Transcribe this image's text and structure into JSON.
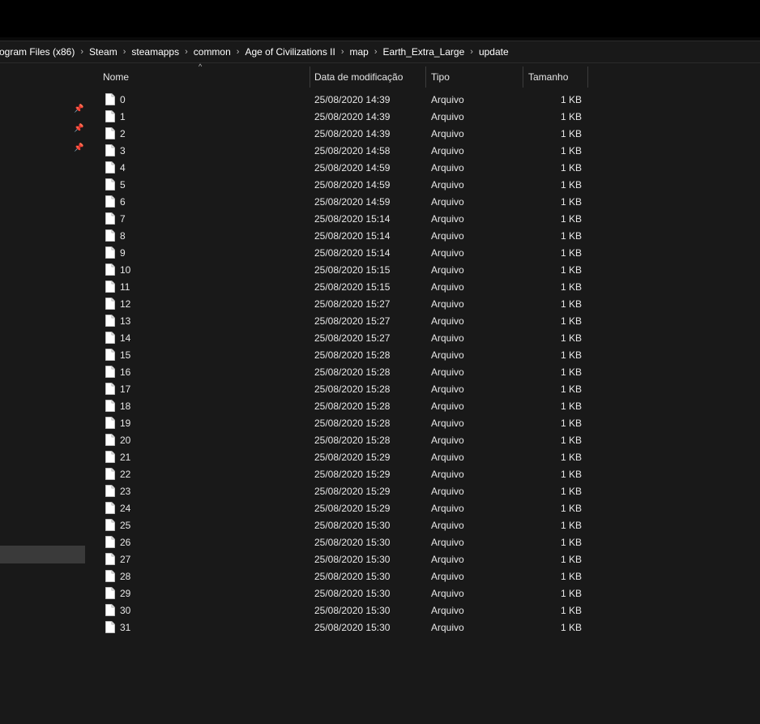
{
  "breadcrumb": [
    "rogram Files (x86)",
    "Steam",
    "steamapps",
    "common",
    "Age of Civilizations II",
    "map",
    "Earth_Extra_Large",
    "update"
  ],
  "breadcrumb_separator": "›",
  "columns": {
    "name": "Nome",
    "date": "Data de modificação",
    "type": "Tipo",
    "size": "Tamanho",
    "sort_indicator": "^"
  },
  "files": [
    {
      "name": "0",
      "date": "25/08/2020 14:39",
      "type": "Arquivo",
      "size": "1 KB"
    },
    {
      "name": "1",
      "date": "25/08/2020 14:39",
      "type": "Arquivo",
      "size": "1 KB"
    },
    {
      "name": "2",
      "date": "25/08/2020 14:39",
      "type": "Arquivo",
      "size": "1 KB"
    },
    {
      "name": "3",
      "date": "25/08/2020 14:58",
      "type": "Arquivo",
      "size": "1 KB"
    },
    {
      "name": "4",
      "date": "25/08/2020 14:59",
      "type": "Arquivo",
      "size": "1 KB"
    },
    {
      "name": "5",
      "date": "25/08/2020 14:59",
      "type": "Arquivo",
      "size": "1 KB"
    },
    {
      "name": "6",
      "date": "25/08/2020 14:59",
      "type": "Arquivo",
      "size": "1 KB"
    },
    {
      "name": "7",
      "date": "25/08/2020 15:14",
      "type": "Arquivo",
      "size": "1 KB"
    },
    {
      "name": "8",
      "date": "25/08/2020 15:14",
      "type": "Arquivo",
      "size": "1 KB"
    },
    {
      "name": "9",
      "date": "25/08/2020 15:14",
      "type": "Arquivo",
      "size": "1 KB"
    },
    {
      "name": "10",
      "date": "25/08/2020 15:15",
      "type": "Arquivo",
      "size": "1 KB"
    },
    {
      "name": "11",
      "date": "25/08/2020 15:15",
      "type": "Arquivo",
      "size": "1 KB"
    },
    {
      "name": "12",
      "date": "25/08/2020 15:27",
      "type": "Arquivo",
      "size": "1 KB"
    },
    {
      "name": "13",
      "date": "25/08/2020 15:27",
      "type": "Arquivo",
      "size": "1 KB"
    },
    {
      "name": "14",
      "date": "25/08/2020 15:27",
      "type": "Arquivo",
      "size": "1 KB"
    },
    {
      "name": "15",
      "date": "25/08/2020 15:28",
      "type": "Arquivo",
      "size": "1 KB"
    },
    {
      "name": "16",
      "date": "25/08/2020 15:28",
      "type": "Arquivo",
      "size": "1 KB"
    },
    {
      "name": "17",
      "date": "25/08/2020 15:28",
      "type": "Arquivo",
      "size": "1 KB"
    },
    {
      "name": "18",
      "date": "25/08/2020 15:28",
      "type": "Arquivo",
      "size": "1 KB"
    },
    {
      "name": "19",
      "date": "25/08/2020 15:28",
      "type": "Arquivo",
      "size": "1 KB"
    },
    {
      "name": "20",
      "date": "25/08/2020 15:28",
      "type": "Arquivo",
      "size": "1 KB"
    },
    {
      "name": "21",
      "date": "25/08/2020 15:29",
      "type": "Arquivo",
      "size": "1 KB"
    },
    {
      "name": "22",
      "date": "25/08/2020 15:29",
      "type": "Arquivo",
      "size": "1 KB"
    },
    {
      "name": "23",
      "date": "25/08/2020 15:29",
      "type": "Arquivo",
      "size": "1 KB"
    },
    {
      "name": "24",
      "date": "25/08/2020 15:29",
      "type": "Arquivo",
      "size": "1 KB"
    },
    {
      "name": "25",
      "date": "25/08/2020 15:30",
      "type": "Arquivo",
      "size": "1 KB"
    },
    {
      "name": "26",
      "date": "25/08/2020 15:30",
      "type": "Arquivo",
      "size": "1 KB"
    },
    {
      "name": "27",
      "date": "25/08/2020 15:30",
      "type": "Arquivo",
      "size": "1 KB"
    },
    {
      "name": "28",
      "date": "25/08/2020 15:30",
      "type": "Arquivo",
      "size": "1 KB"
    },
    {
      "name": "29",
      "date": "25/08/2020 15:30",
      "type": "Arquivo",
      "size": "1 KB"
    },
    {
      "name": "30",
      "date": "25/08/2020 15:30",
      "type": "Arquivo",
      "size": "1 KB"
    },
    {
      "name": "31",
      "date": "25/08/2020 15:30",
      "type": "Arquivo",
      "size": "1 KB"
    }
  ],
  "icons": {
    "file": "file-icon",
    "pin": "pin-icon"
  },
  "colors": {
    "background": "#191919",
    "titlebar": "#000000",
    "selection": "#3a3a3a",
    "text": "#e8e8e8"
  }
}
